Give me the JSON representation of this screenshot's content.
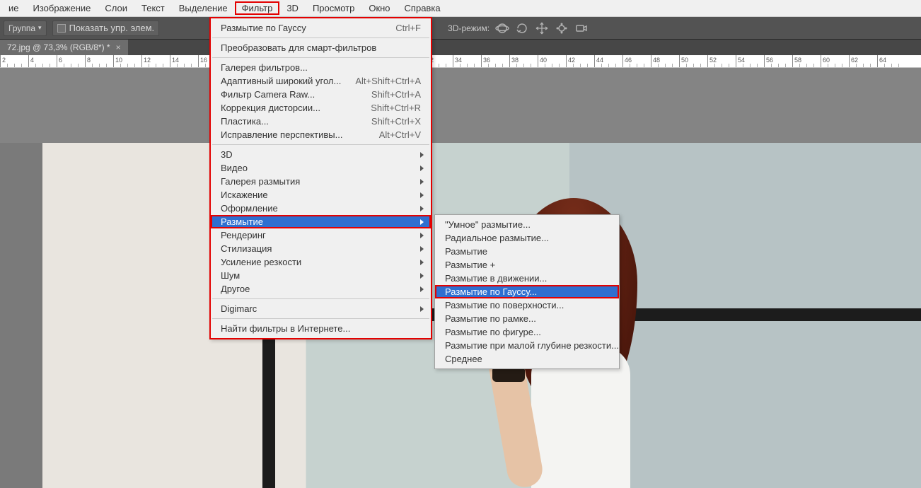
{
  "menu": {
    "items": [
      "ие",
      "Изображение",
      "Слои",
      "Текст",
      "Выделение",
      "Фильтр",
      "3D",
      "Просмотр",
      "Окно",
      "Справка"
    ],
    "activeIndex": 5
  },
  "options": {
    "groupLabel": "Группа",
    "showControls": "Показать упр. элем.",
    "modeLabel": "3D-режим:"
  },
  "tab": {
    "title": "72.jpg @ 73,3% (RGB/8*) *",
    "close": "×"
  },
  "ruler": {
    "start": 2,
    "end": 64,
    "step": 2,
    "pxPerStep": 40
  },
  "filterMenu": {
    "sections": [
      [
        {
          "label": "Размытие по Гауссу",
          "shortcut": "Ctrl+F"
        }
      ],
      [
        {
          "label": "Преобразовать для смарт-фильтров"
        }
      ],
      [
        {
          "label": "Галерея фильтров..."
        },
        {
          "label": "Адаптивный широкий угол...",
          "shortcut": "Alt+Shift+Ctrl+A"
        },
        {
          "label": "Фильтр Camera Raw...",
          "shortcut": "Shift+Ctrl+A"
        },
        {
          "label": "Коррекция дисторсии...",
          "shortcut": "Shift+Ctrl+R"
        },
        {
          "label": "Пластика...",
          "shortcut": "Shift+Ctrl+X"
        },
        {
          "label": "Исправление перспективы...",
          "shortcut": "Alt+Ctrl+V"
        }
      ],
      [
        {
          "label": "3D",
          "sub": true
        },
        {
          "label": "Видео",
          "sub": true
        },
        {
          "label": "Галерея размытия",
          "sub": true
        },
        {
          "label": "Искажение",
          "sub": true
        },
        {
          "label": "Оформление",
          "sub": true
        },
        {
          "label": "Размытие",
          "sub": true,
          "selected": true
        },
        {
          "label": "Рендеринг",
          "sub": true
        },
        {
          "label": "Стилизация",
          "sub": true
        },
        {
          "label": "Усиление резкости",
          "sub": true
        },
        {
          "label": "Шум",
          "sub": true
        },
        {
          "label": "Другое",
          "sub": true
        }
      ],
      [
        {
          "label": "Digimarc",
          "sub": true
        }
      ],
      [
        {
          "label": "Найти фильтры в Интернете..."
        }
      ]
    ]
  },
  "blurSubmenu": {
    "items": [
      {
        "label": "\"Умное\" размытие..."
      },
      {
        "label": "Радиальное размытие..."
      },
      {
        "label": "Размытие"
      },
      {
        "label": "Размытие +"
      },
      {
        "label": "Размытие в движении..."
      },
      {
        "label": "Размытие по Гауссу...",
        "selected": true
      },
      {
        "label": "Размытие по поверхности..."
      },
      {
        "label": "Размытие по рамке..."
      },
      {
        "label": "Размытие по фигуре..."
      },
      {
        "label": "Размытие при малой глубине резкости..."
      },
      {
        "label": "Среднее"
      }
    ]
  }
}
